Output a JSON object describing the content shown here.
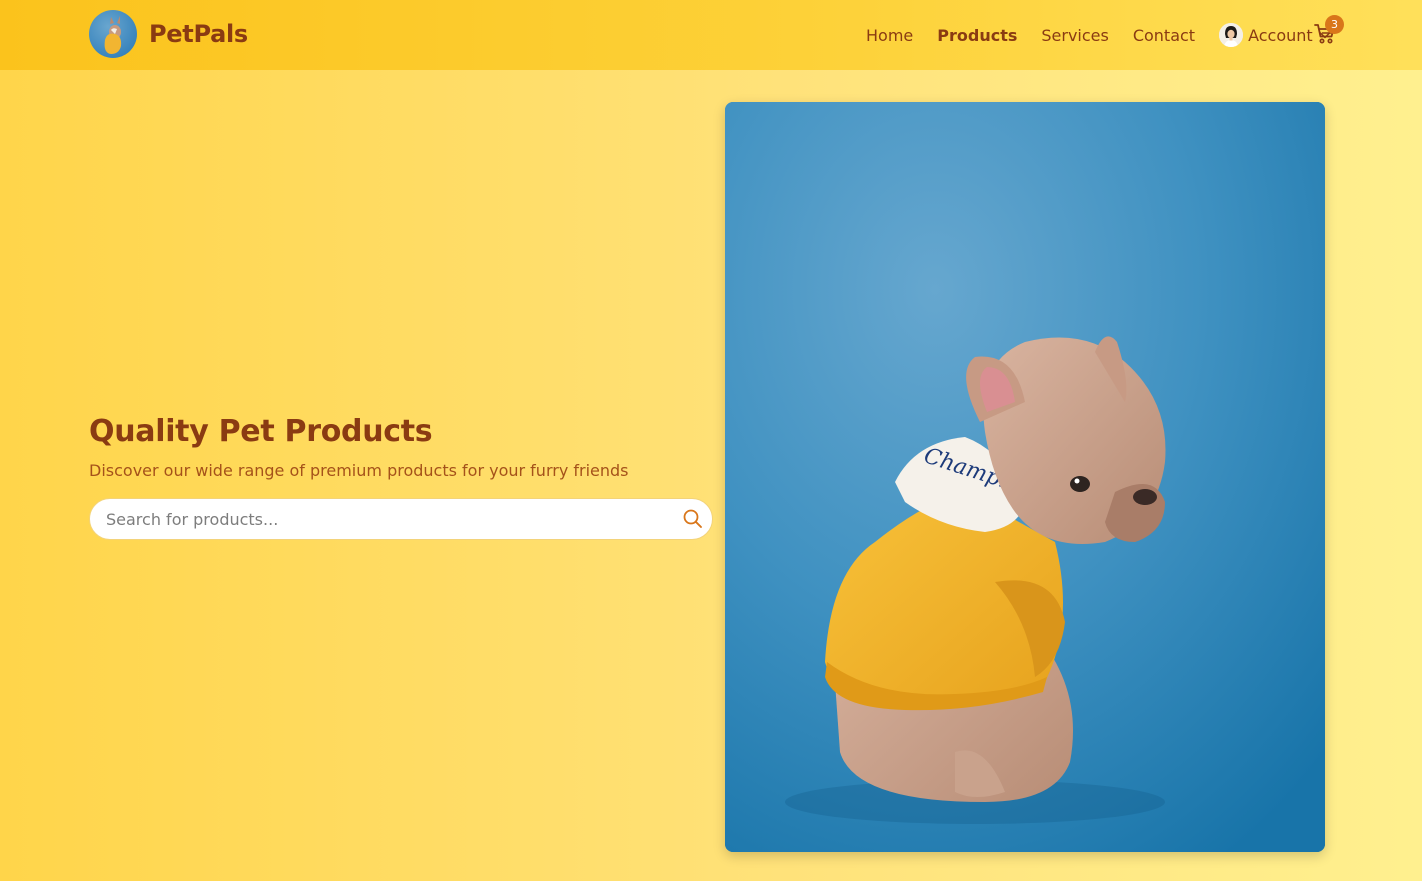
{
  "brand": {
    "name": "PetPals",
    "logo_icon": "dog-logo-icon"
  },
  "nav": {
    "items": [
      {
        "label": "Home",
        "active": false
      },
      {
        "label": "Products",
        "active": true
      },
      {
        "label": "Services",
        "active": false
      },
      {
        "label": "Contact",
        "active": false
      }
    ],
    "account_label": "Account",
    "cart_count": "3"
  },
  "hero": {
    "title": "Quality Pet Products",
    "subtitle": "Discover our wide range of premium products for your furry friends",
    "search_placeholder": "Search for products..."
  },
  "image": {
    "alt": "French bulldog wearing a yellow hoodie",
    "hoodie_text": "Champion"
  },
  "colors": {
    "brand": "#8a3b12",
    "header": "#fdd23a",
    "accent": "#d9761a",
    "photo_bg": "#3d8fbf"
  }
}
